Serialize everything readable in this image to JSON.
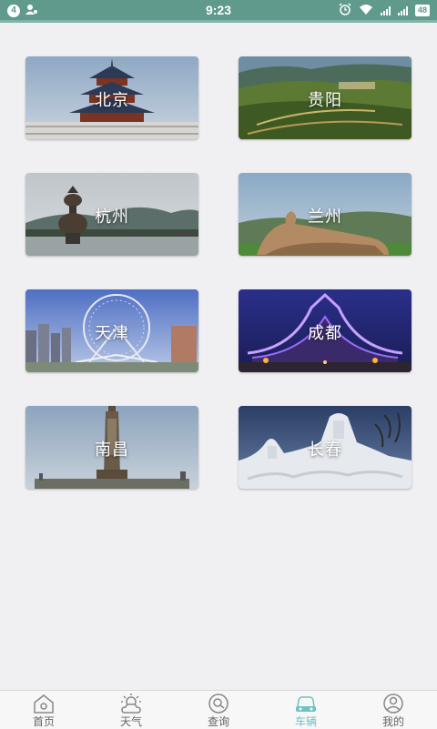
{
  "status": {
    "notification_count": "4",
    "time": "9:23",
    "battery": "48"
  },
  "cities": [
    {
      "name": "北京"
    },
    {
      "name": "贵阳"
    },
    {
      "name": "杭州"
    },
    {
      "name": "兰州"
    },
    {
      "name": "天津"
    },
    {
      "name": "成都"
    },
    {
      "name": "南昌"
    },
    {
      "name": "长春"
    }
  ],
  "nav": {
    "items": [
      {
        "label": "首页",
        "icon": "home-icon"
      },
      {
        "label": "天气",
        "icon": "weather-icon"
      },
      {
        "label": "查询",
        "icon": "search-icon"
      },
      {
        "label": "车辆",
        "icon": "vehicle-icon",
        "active": true
      },
      {
        "label": "我的",
        "icon": "profile-icon"
      }
    ],
    "active_color": "#6cc3c4",
    "inactive_color": "#666666"
  }
}
